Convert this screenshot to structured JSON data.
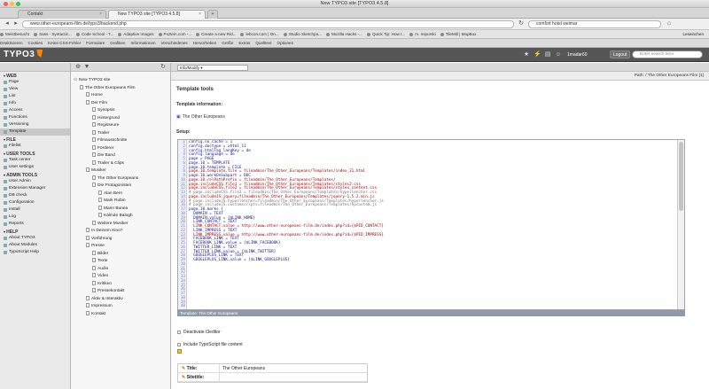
{
  "window": {
    "title": "New TYPO3 site [TYPO3 4.5.8]"
  },
  "tabs": [
    {
      "label": "Contakt",
      "active": false
    },
    {
      "label": "New TYPO3 site [TYPO3 4.5.8]",
      "active": true
    }
  ],
  "url": "www.other-europeans-film.de/typo3/backend.php",
  "browser_search": "comfort hotel weimar",
  "reading_list": "Leseinchen",
  "bookmarks": [
    "Meistbesucht",
    "Sass - Syntactic...",
    "Code School - T...",
    "Adaptive Images",
    "Pxztein.com -...",
    "Create a new Rid...",
    "lebcon.com | On...",
    "Studio Sketchpa...",
    "Mozilla Hacks -...",
    "Quick Tip: How t...",
    "m. mipurski",
    "TileMill | MapBox"
  ],
  "devtools": [
    "Deaktivieren",
    "Cookies",
    "Keine CSS-Fehler",
    "Formulare",
    "Grafiken",
    "Informationen",
    "Verschiedenes",
    "Hervorheben",
    "Größe",
    "Extras",
    "Quelltext",
    "Optionen"
  ],
  "typo3": {
    "logo": "TYPO3",
    "user": "1madar60",
    "logout": "Logout",
    "search_placeholder": "Enter search term"
  },
  "modules": [
    {
      "group": "WEB",
      "items": [
        {
          "label": "Page"
        },
        {
          "label": "View"
        },
        {
          "label": "List"
        },
        {
          "label": "Info"
        },
        {
          "label": "Access"
        },
        {
          "label": "Functions"
        },
        {
          "label": "Versioning"
        },
        {
          "label": "Template",
          "selected": true
        }
      ]
    },
    {
      "group": "FILE",
      "items": [
        {
          "label": "Filelist"
        }
      ]
    },
    {
      "group": "USER TOOLS",
      "items": [
        {
          "label": "Task center"
        },
        {
          "label": "User settings"
        }
      ]
    },
    {
      "group": "ADMIN TOOLS",
      "items": [
        {
          "label": "User Admin"
        },
        {
          "label": "Extension Manager"
        },
        {
          "label": "DB check"
        },
        {
          "label": "Configuration"
        },
        {
          "label": "Install"
        },
        {
          "label": "Log"
        },
        {
          "label": "Reports"
        }
      ]
    },
    {
      "group": "HELP",
      "items": [
        {
          "label": "About TYPO3"
        },
        {
          "label": "About Modules"
        },
        {
          "label": "TypoScript Help"
        }
      ]
    }
  ],
  "tree": [
    {
      "label": "New TYPO3 site",
      "depth": 0
    },
    {
      "label": "The Other Europeans Film",
      "depth": 1
    },
    {
      "label": "Home",
      "depth": 2
    },
    {
      "label": "Der Film",
      "depth": 2
    },
    {
      "label": "Synopsis",
      "depth": 3
    },
    {
      "label": "Hintergrund",
      "depth": 3
    },
    {
      "label": "Regisseure",
      "depth": 3
    },
    {
      "label": "Trailer",
      "depth": 3
    },
    {
      "label": "Filmausschnitte",
      "depth": 3
    },
    {
      "label": "Förderer",
      "depth": 3
    },
    {
      "label": "Die Band",
      "depth": 3
    },
    {
      "label": "Trailer & Clips",
      "depth": 3
    },
    {
      "label": "Musiker",
      "depth": 2
    },
    {
      "label": "The Other Europeans",
      "depth": 3
    },
    {
      "label": "Die Protagonisten",
      "depth": 3
    },
    {
      "label": "Alan Bern",
      "depth": 4
    },
    {
      "label": "Mark Rubin",
      "depth": 4
    },
    {
      "label": "Marin Bunea",
      "depth": 4
    },
    {
      "label": "Kálmán Balogh",
      "depth": 4
    },
    {
      "label": "Weitere Musiker",
      "depth": 3
    },
    {
      "label": "In Deinem Kino?",
      "depth": 2
    },
    {
      "label": "Vorführung",
      "depth": 2
    },
    {
      "label": "Presse",
      "depth": 2
    },
    {
      "label": "Bilder",
      "depth": 3
    },
    {
      "label": "Texte",
      "depth": 3
    },
    {
      "label": "Audio",
      "depth": 3
    },
    {
      "label": "Video",
      "depth": 3
    },
    {
      "label": "Kritiken",
      "depth": 3
    },
    {
      "label": "Pressekontakt",
      "depth": 3
    },
    {
      "label": "Aktiv & Interaktiv",
      "depth": 2
    },
    {
      "label": "Impressum",
      "depth": 2
    },
    {
      "label": "Kontakt",
      "depth": 2
    }
  ],
  "content": {
    "select_value": "Info/Modify",
    "path_label": "Path: / The Other Europeans Film [1]",
    "heading": "Template tools",
    "template_info_label": "Template information:",
    "template_name": "The Other Europeans",
    "setup_label": "Setup:",
    "editor_footer": "Template: The Other Europeans",
    "deactivate_label": "Deactivate t3editor",
    "include_label": "Include TypoScript file content",
    "rows": [
      {
        "key": "Title:",
        "value": "The Other Europeans"
      },
      {
        "key": "Sitetitle:",
        "value": ""
      }
    ]
  },
  "code_lines": [
    "config.no_cache = 1",
    "",
    "",
    "config.doctype = xhtml_11",
    "config.htmlTag_langKey = de",
    "config.language = de",
    "",
    "page = PAGE",
    "page.10 = TEMPLATE",
    "page.10.template = FILE",
    "page.10.template.file = fileadmin/The_Other_Europeans/Templates/index_31.html",
    "page.10.workOnSubpart = DOC",
    "page.10.relPathPrefix = fileadmin/The_Other_Europeans/Templates/",
    "page.includeCSS.file1 = fileadmin/The_Other_Europeans/Templates/styles2.css",
    "page.includeCSS.file2 = fileadmin/The_Other_Europeans/Templates/stylex_content.css",
    "# page.includeCSS.file3 = fileadmin/The_Other_Europeans/Templates/hyperlencher.css",
    "page.includeJS.jquery=fileadmin/The_Other_Europeans/Templates/jquery-1.5.2.min.js",
    "# page.includeJS.hyperlencher=fileadmin/The_Other_Europeans/Templates/hyperlencher.js",
    "# page.includeJS.customscripts=fileadmin/The_Other_Europeans/Templates/hpcustom.js",
    "",
    "",
    "page.10.marks {",
    "  DOMAIN = TEXT",
    "  DOMAIN.value = {$LINK_HOME}",
    "  LINK_CONTACT = TEXT",
    "  LINK_CONTACT.value = http://www.other-europeans-film.de/index.php?id={$PID_CONTACT}",
    "  LINK_IMPRESS = TEXT",
    "  LINK_IMPRESS.value = http://www.other-europeans-film.de/index.php?id={$PID_IMPRESS}",
    "  FACEBOOK_LINK = TEXT",
    "  FACEBOOK_LINK.value = {$LINK_FACEBOOK}",
    "  TWITTER_LINK = TEXT",
    "  TWITTER_LINK.value = {$LINK_TWITTER}",
    "  GOOGLEPLUS_LINK = TEXT",
    "  GOOGLEPLUS_LINK.value = {$LINK_GOOGLEPLUS}",
    "",
    "",
    "",
    "",
    "",
    ""
  ],
  "colors": {
    "typo3_header": "#565656",
    "typo3_orange": "#ff8700",
    "editor_footer": "#8e9aaa"
  }
}
